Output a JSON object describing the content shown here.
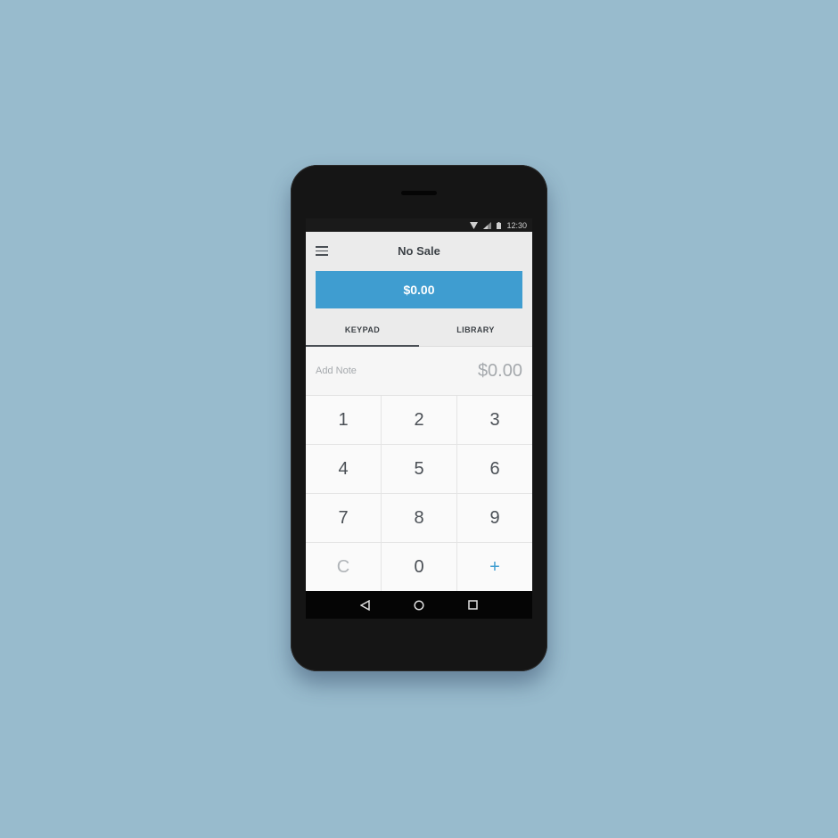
{
  "status_bar": {
    "time": "12:30",
    "icons": [
      "wifi-icon",
      "signal-icon",
      "battery-icon"
    ]
  },
  "header": {
    "title": "No Sale",
    "menu_icon": "hamburger-menu-icon"
  },
  "charge_button": {
    "label": "$0.00",
    "color": "#3f9dd0"
  },
  "tabs": [
    {
      "label": "KEYPAD",
      "active": true
    },
    {
      "label": "LIBRARY",
      "active": false
    }
  ],
  "note_row": {
    "placeholder": "Add Note",
    "amount": "$0.00"
  },
  "keypad": {
    "keys": [
      "1",
      "2",
      "3",
      "4",
      "5",
      "6",
      "7",
      "8",
      "9",
      "C",
      "0",
      "+"
    ]
  },
  "nav_bar": {
    "icons": [
      "back-icon",
      "home-icon",
      "recents-icon"
    ]
  },
  "colors": {
    "background": "#98bbcd",
    "accent": "#3f9dd0"
  }
}
